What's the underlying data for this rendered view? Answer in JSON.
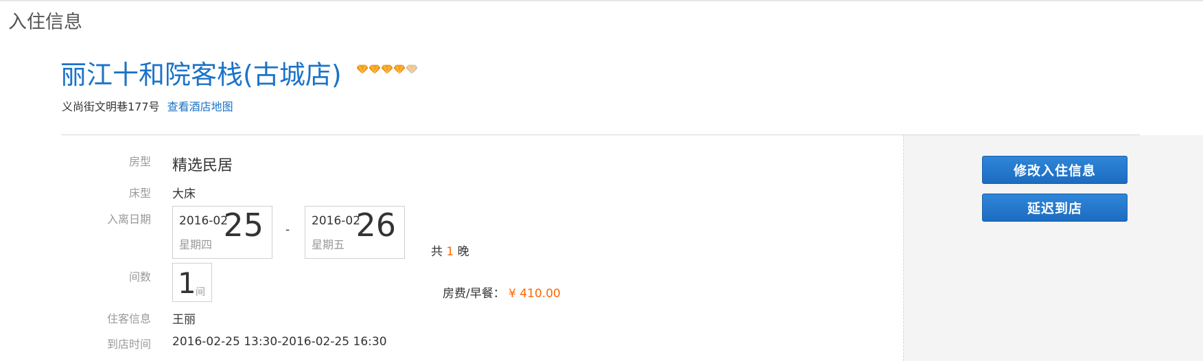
{
  "section_title": "入住信息",
  "hotel": {
    "name": "丽江十和院客栈(古城店)",
    "diamond_rating": 5,
    "address": "义尚街文明巷177号",
    "map_link": "查看酒店地图"
  },
  "labels": {
    "room_type": "房型",
    "bed_type": "床型",
    "dates": "入离日期",
    "rooms": "间数",
    "guest": "住客信息",
    "arrival": "到店时间"
  },
  "booking": {
    "room_type": "精选民居",
    "bed_type": "大床",
    "checkin": {
      "ym": "2016-02",
      "day": "25",
      "weekday": "星期四"
    },
    "date_separator": "-",
    "checkout": {
      "ym": "2016-02",
      "day": "26",
      "weekday": "星期五"
    },
    "nights_prefix": "共",
    "nights_count": "1",
    "nights_suffix": "晚",
    "rooms_count": "1",
    "rooms_unit": "间",
    "price_label": "房费/早餐：",
    "price_value": "¥ 410.00",
    "guest": "王丽",
    "arrival_time": "2016-02-25 13:30-2016-02-25 16:30"
  },
  "actions": {
    "modify": "修改入住信息",
    "delay": "延迟到店"
  },
  "colors": {
    "link_blue": "#1a73c8",
    "button_blue": "#1c6cc0",
    "accent_orange": "#ff6600",
    "diamond_orange": "#f7a21b"
  }
}
